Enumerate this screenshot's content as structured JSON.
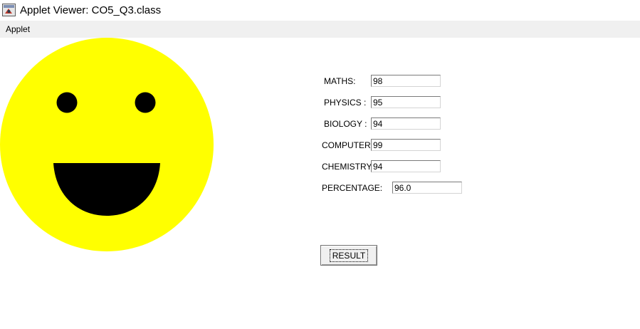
{
  "window": {
    "title": "Applet Viewer: CO5_Q3.class",
    "icon": "java-applet-icon"
  },
  "menu": {
    "items": [
      {
        "label": "Applet"
      }
    ]
  },
  "smiley": {
    "face_color": "#ffff00",
    "feature_color": "#000000"
  },
  "form": {
    "fields": [
      {
        "label": "MATHS:",
        "value": "98"
      },
      {
        "label": "PHYSICS :",
        "value": "95"
      },
      {
        "label": "BIOLOGY :",
        "value": "94"
      },
      {
        "label": "COMPUTER",
        "value": "99"
      },
      {
        "label": "CHEMISTRY",
        "value": "94"
      }
    ],
    "percentage": {
      "label": "PERCENTAGE:",
      "value": "96.0"
    },
    "result_button": "RESULT"
  }
}
